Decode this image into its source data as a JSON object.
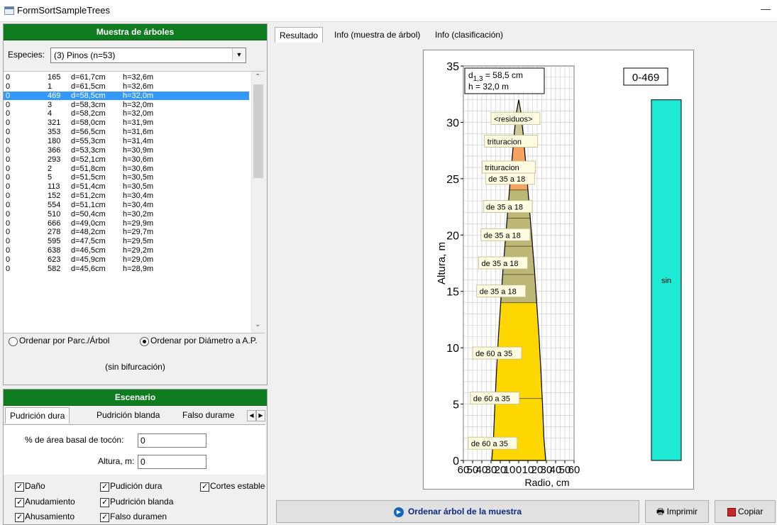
{
  "window": {
    "title": "FormSortSampleTrees",
    "minimize": "—"
  },
  "sample_panel": {
    "header": "Muestra de árboles",
    "species_label": "Especies:",
    "species_value": "(3) Pinos  (n=53)",
    "rows": [
      {
        "n": "0",
        "id": "165",
        "d": "d=61,7cm",
        "h": "h=32,6m"
      },
      {
        "n": "0",
        "id": "1",
        "d": "d=61,5cm",
        "h": "h=32,6m"
      },
      {
        "n": "0",
        "id": "469",
        "d": "d=58,5cm",
        "h": "h=32,0m",
        "selected": true
      },
      {
        "n": "0",
        "id": "3",
        "d": "d=58,3cm",
        "h": "h=32,0m"
      },
      {
        "n": "0",
        "id": "4",
        "d": "d=58,2cm",
        "h": "h=32,0m"
      },
      {
        "n": "0",
        "id": "321",
        "d": "d=58,0cm",
        "h": "h=31,9m"
      },
      {
        "n": "0",
        "id": "353",
        "d": "d=56,5cm",
        "h": "h=31,6m"
      },
      {
        "n": "0",
        "id": "180",
        "d": "d=55,3cm",
        "h": "h=31,4m"
      },
      {
        "n": "0",
        "id": "366",
        "d": "d=53,3cm",
        "h": "h=30,9m"
      },
      {
        "n": "0",
        "id": "293",
        "d": "d=52,1cm",
        "h": "h=30,6m"
      },
      {
        "n": "0",
        "id": "2",
        "d": "d=51,8cm",
        "h": "h=30,6m"
      },
      {
        "n": "0",
        "id": "5",
        "d": "d=51,5cm",
        "h": "h=30,5m"
      },
      {
        "n": "0",
        "id": "113",
        "d": "d=51,4cm",
        "h": "h=30,5m"
      },
      {
        "n": "0",
        "id": "152",
        "d": "d=51,2cm",
        "h": "h=30,4m"
      },
      {
        "n": "0",
        "id": "554",
        "d": "d=51,1cm",
        "h": "h=30,4m"
      },
      {
        "n": "0",
        "id": "510",
        "d": "d=50,4cm",
        "h": "h=30,2m"
      },
      {
        "n": "0",
        "id": "666",
        "d": "d=49,0cm",
        "h": "h=29,9m"
      },
      {
        "n": "0",
        "id": "278",
        "d": "d=48,2cm",
        "h": "h=29,7m"
      },
      {
        "n": "0",
        "id": "595",
        "d": "d=47,5cm",
        "h": "h=29,5m"
      },
      {
        "n": "0",
        "id": "638",
        "d": "d=46,5cm",
        "h": "h=29,2m"
      },
      {
        "n": "0",
        "id": "623",
        "d": "d=45,9cm",
        "h": "h=29,0m"
      },
      {
        "n": "0",
        "id": "582",
        "d": "d=45,6cm",
        "h": "h=28,9m"
      }
    ],
    "sort_plot": "Ordenar por Parc./Árbol",
    "sort_diam": "Ordenar por Diámetro a A.P.",
    "sort_selected": "diam",
    "bifurcation": "(sin bifurcación)"
  },
  "scenario": {
    "header": "Escenario",
    "tabs": [
      "Pudrición dura",
      "Pudrición blanda",
      "Falso durame"
    ],
    "active_tab": 0,
    "basal_label": "% de área basal de tocón:",
    "basal_value": "0",
    "height_label": "Altura, m:",
    "height_value": "0",
    "checks": [
      {
        "label": "Daño",
        "checked": true
      },
      {
        "label": "Pudición dura",
        "checked": true
      },
      {
        "label": "Cortes estable",
        "checked": true
      },
      {
        "label": "Anudamiento",
        "checked": true
      },
      {
        "label": "Pudrición blanda",
        "checked": true
      },
      {
        "label": "Ahusamiento",
        "checked": true
      },
      {
        "label": "Falso duramen",
        "checked": true
      }
    ]
  },
  "main_tabs": [
    "Resultado",
    "Info (muestra de árbol)",
    "Info (clasificación)"
  ],
  "active_main_tab": 0,
  "chart_data": {
    "type": "area",
    "tree_id": "0-469",
    "d13_label": "d",
    "d13_sub": "1,3",
    "d13_value": " = 58,5 cm",
    "h_text": "h = 32,0 m",
    "xlabel": "Radio, cm",
    "ylabel": "Altura, m",
    "xlim": [
      -60,
      60
    ],
    "ylim": [
      0,
      35
    ],
    "xticks": [
      "60",
      "50",
      "40",
      "30",
      "20",
      "10",
      "0",
      "10",
      "20",
      "30",
      "40",
      "50",
      "60"
    ],
    "yticks": [
      0,
      5,
      10,
      15,
      20,
      25,
      30,
      35
    ],
    "grid": true,
    "stem_height": 32.0,
    "base_radius": 29.25,
    "profile": [
      [
        0,
        29.25
      ],
      [
        2,
        27.3
      ],
      [
        5,
        25.8
      ],
      [
        8,
        24.0
      ],
      [
        11,
        22.0
      ],
      [
        14,
        19.5
      ],
      [
        17,
        17.0
      ],
      [
        20,
        14.0
      ],
      [
        23,
        11.0
      ],
      [
        26,
        8.0
      ],
      [
        29,
        4.8
      ],
      [
        31,
        2.2
      ],
      [
        32,
        0
      ]
    ],
    "segments": [
      {
        "from": 0,
        "to": 14,
        "label": "de 60 a 35",
        "color": "#ffd700",
        "label_heights": [
          1.5,
          5.5,
          9.5
        ]
      },
      {
        "from": 14,
        "to": 24,
        "label": "de 35 a 18",
        "color": "#bdb776",
        "label_heights": [
          15,
          17.5,
          20,
          22.5,
          25
        ]
      },
      {
        "from": 24,
        "to": 28.8,
        "label": "trituracion",
        "color": "#f4a460",
        "label_heights": [
          26,
          28.3
        ]
      },
      {
        "from": 28.8,
        "to": 32,
        "label": "<residuos>",
        "color": "#d2c49a",
        "label_heights": [
          30.3
        ]
      }
    ],
    "dividers": [
      5.5,
      14,
      16.5,
      19,
      21.5,
      24,
      26.5,
      28.8
    ],
    "side_bar": {
      "label": "sin",
      "color": "#1de9d4",
      "height": 32
    }
  },
  "bottom": {
    "sort_button": "Ordenar árbol de la muestra",
    "print_button": "Imprimir",
    "copy_button": "Copiar"
  }
}
